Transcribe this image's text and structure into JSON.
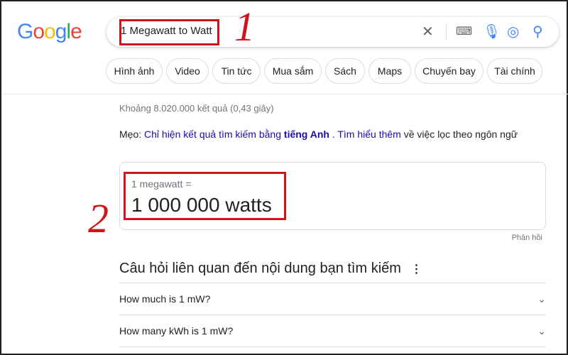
{
  "logo": "Google",
  "search": {
    "query": "1 Megawatt to Watt"
  },
  "annotations": [
    "1",
    "2"
  ],
  "chips": [
    "Hình ảnh",
    "Video",
    "Tin tức",
    "Mua sắm",
    "Sách",
    "Maps",
    "Chuyến bay",
    "Tài chính"
  ],
  "stats": "Khoảng 8.020.000 kết quả (0,43 giây)",
  "tip": {
    "prefix": "Mẹo:",
    "link1": "Chỉ hiện kết quả tìm kiếm bằng",
    "bold": "tiếng Anh",
    "sep": ".",
    "link2": "Tìm hiểu thêm",
    "suffix": "về việc lọc theo ngôn ngữ"
  },
  "converter": {
    "from": "1 megawatt =",
    "to": "1 000 000 watts"
  },
  "feedback": "Phản hồi",
  "paa": {
    "title": "Câu hỏi liên quan đến nội dung bạn tìm kiếm",
    "questions": [
      "How much is 1 mW?",
      "How many kWh is 1 mW?"
    ]
  },
  "colors": {
    "annotation": "#d0141b",
    "link": "#1a0dab"
  }
}
